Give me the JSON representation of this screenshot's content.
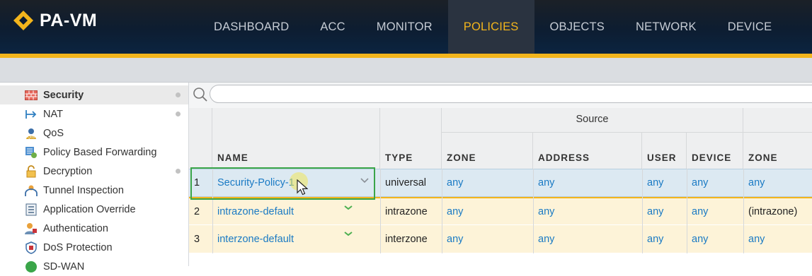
{
  "app": {
    "title": "PA-VM",
    "accent_color": "#f3b51c",
    "header_color": "#0d1d31"
  },
  "nav": {
    "items": [
      "DASHBOARD",
      "ACC",
      "MONITOR",
      "POLICIES",
      "OBJECTS",
      "NETWORK",
      "DEVICE"
    ],
    "active": "POLICIES"
  },
  "sidebar": {
    "items": [
      {
        "label": "Security",
        "icon": "firewall-icon",
        "active": true,
        "dot": true
      },
      {
        "label": "NAT",
        "icon": "nat-arrow-icon",
        "dot": true
      },
      {
        "label": "QoS",
        "icon": "qos-icon"
      },
      {
        "label": "Policy Based Forwarding",
        "icon": "pbf-icon"
      },
      {
        "label": "Decryption",
        "icon": "lock-icon",
        "dot": true
      },
      {
        "label": "Tunnel Inspection",
        "icon": "tunnel-icon"
      },
      {
        "label": "Application Override",
        "icon": "app-override-icon"
      },
      {
        "label": "Authentication",
        "icon": "authentication-icon"
      },
      {
        "label": "DoS Protection",
        "icon": "dos-shield-icon"
      },
      {
        "label": "SD-WAN",
        "icon": "sdwan-icon"
      }
    ]
  },
  "search": {
    "placeholder": "",
    "value": ""
  },
  "table": {
    "group_source": "Source",
    "columns": {
      "name": "NAME",
      "type": "TYPE",
      "src_zone": "ZONE",
      "src_address": "ADDRESS",
      "src_user": "USER",
      "src_device": "DEVICE",
      "dst_zone": "ZONE"
    },
    "rows": [
      {
        "num": "1",
        "name": "Security-Policy-1",
        "type": "universal",
        "src_zone": "any",
        "src_address": "any",
        "src_user": "any",
        "src_device": "any",
        "dst_zone": "any",
        "selected": true
      },
      {
        "num": "2",
        "name": "intrazone-default",
        "type": "intrazone",
        "src_zone": "any",
        "src_address": "any",
        "src_user": "any",
        "src_device": "any",
        "dst_zone": "(intrazone)"
      },
      {
        "num": "3",
        "name": "interzone-default",
        "type": "interzone",
        "src_zone": "any",
        "src_address": "any",
        "src_user": "any",
        "src_device": "any",
        "dst_zone": "any"
      }
    ]
  }
}
